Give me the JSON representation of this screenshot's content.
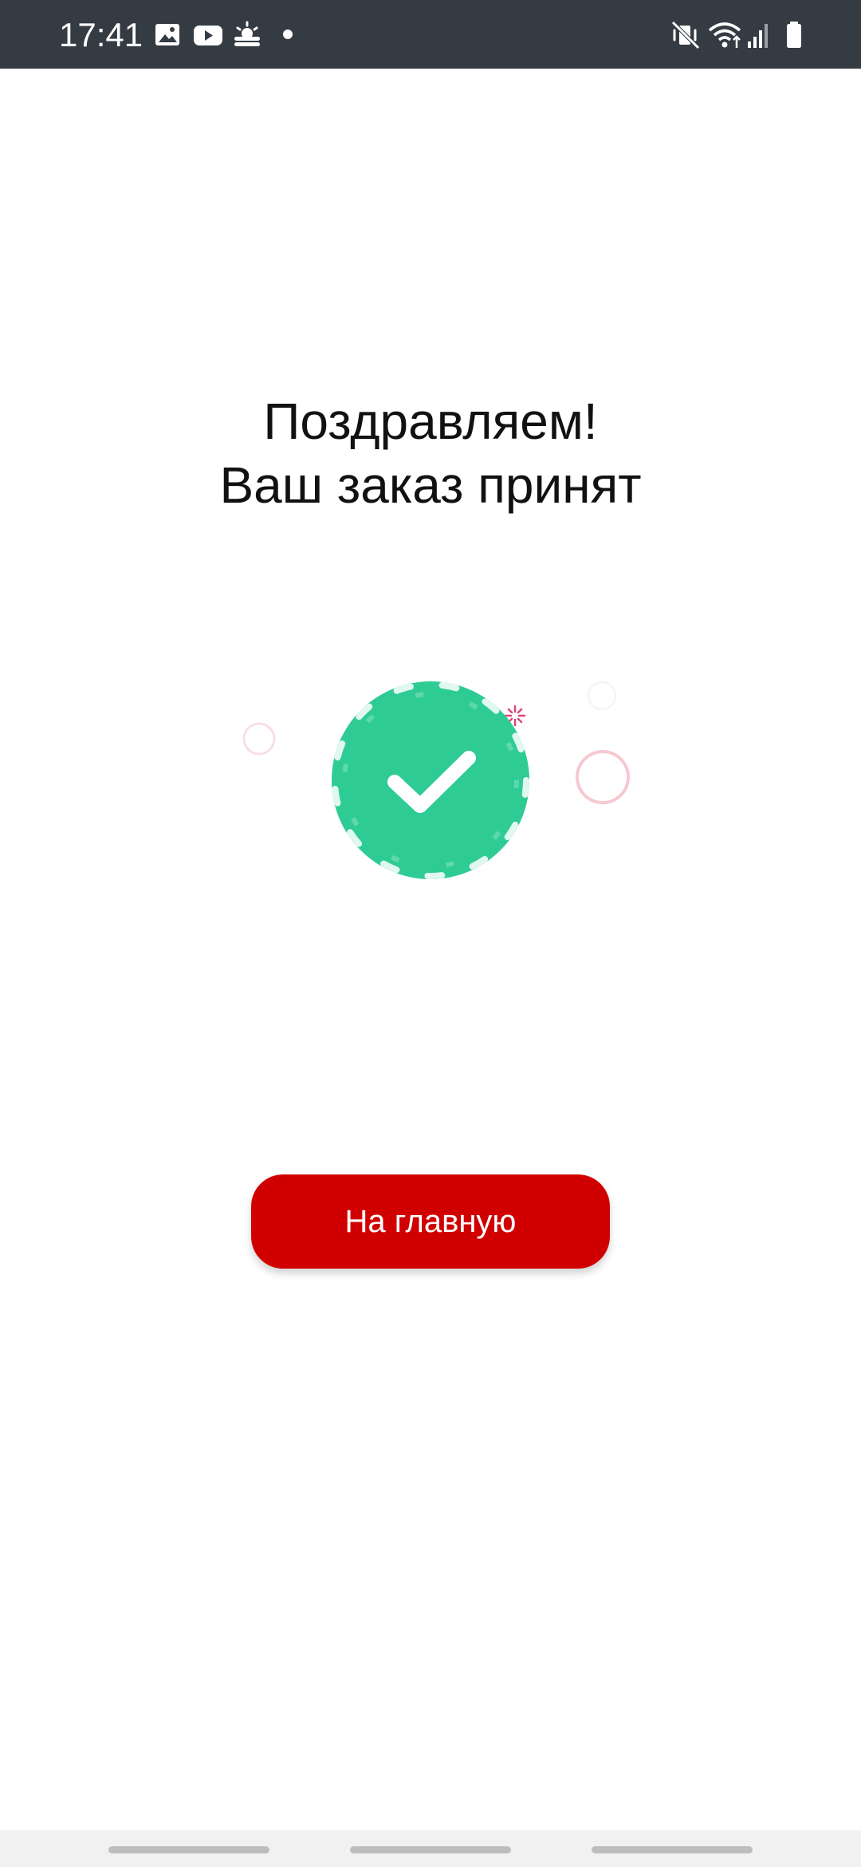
{
  "status_bar": {
    "time": "17:41",
    "left_icons": [
      "gallery-icon",
      "youtube-icon",
      "weather-icon",
      "notification-dot-icon"
    ],
    "right_icons": [
      "mute-vibrate-icon",
      "wifi-icon",
      "signal-icon",
      "battery-icon"
    ],
    "background_color": "#353b43"
  },
  "main": {
    "title_line1": "Поздравляем!",
    "title_line2": "Ваш заказ принят",
    "success_icon": "check-circle-icon",
    "success_color": "#2ecc94"
  },
  "actions": {
    "home_label": "На главную",
    "button_color": "#d10000"
  },
  "nav_bar": {
    "handles": [
      "nav-handle-left",
      "nav-handle-center",
      "nav-handle-right"
    ]
  }
}
